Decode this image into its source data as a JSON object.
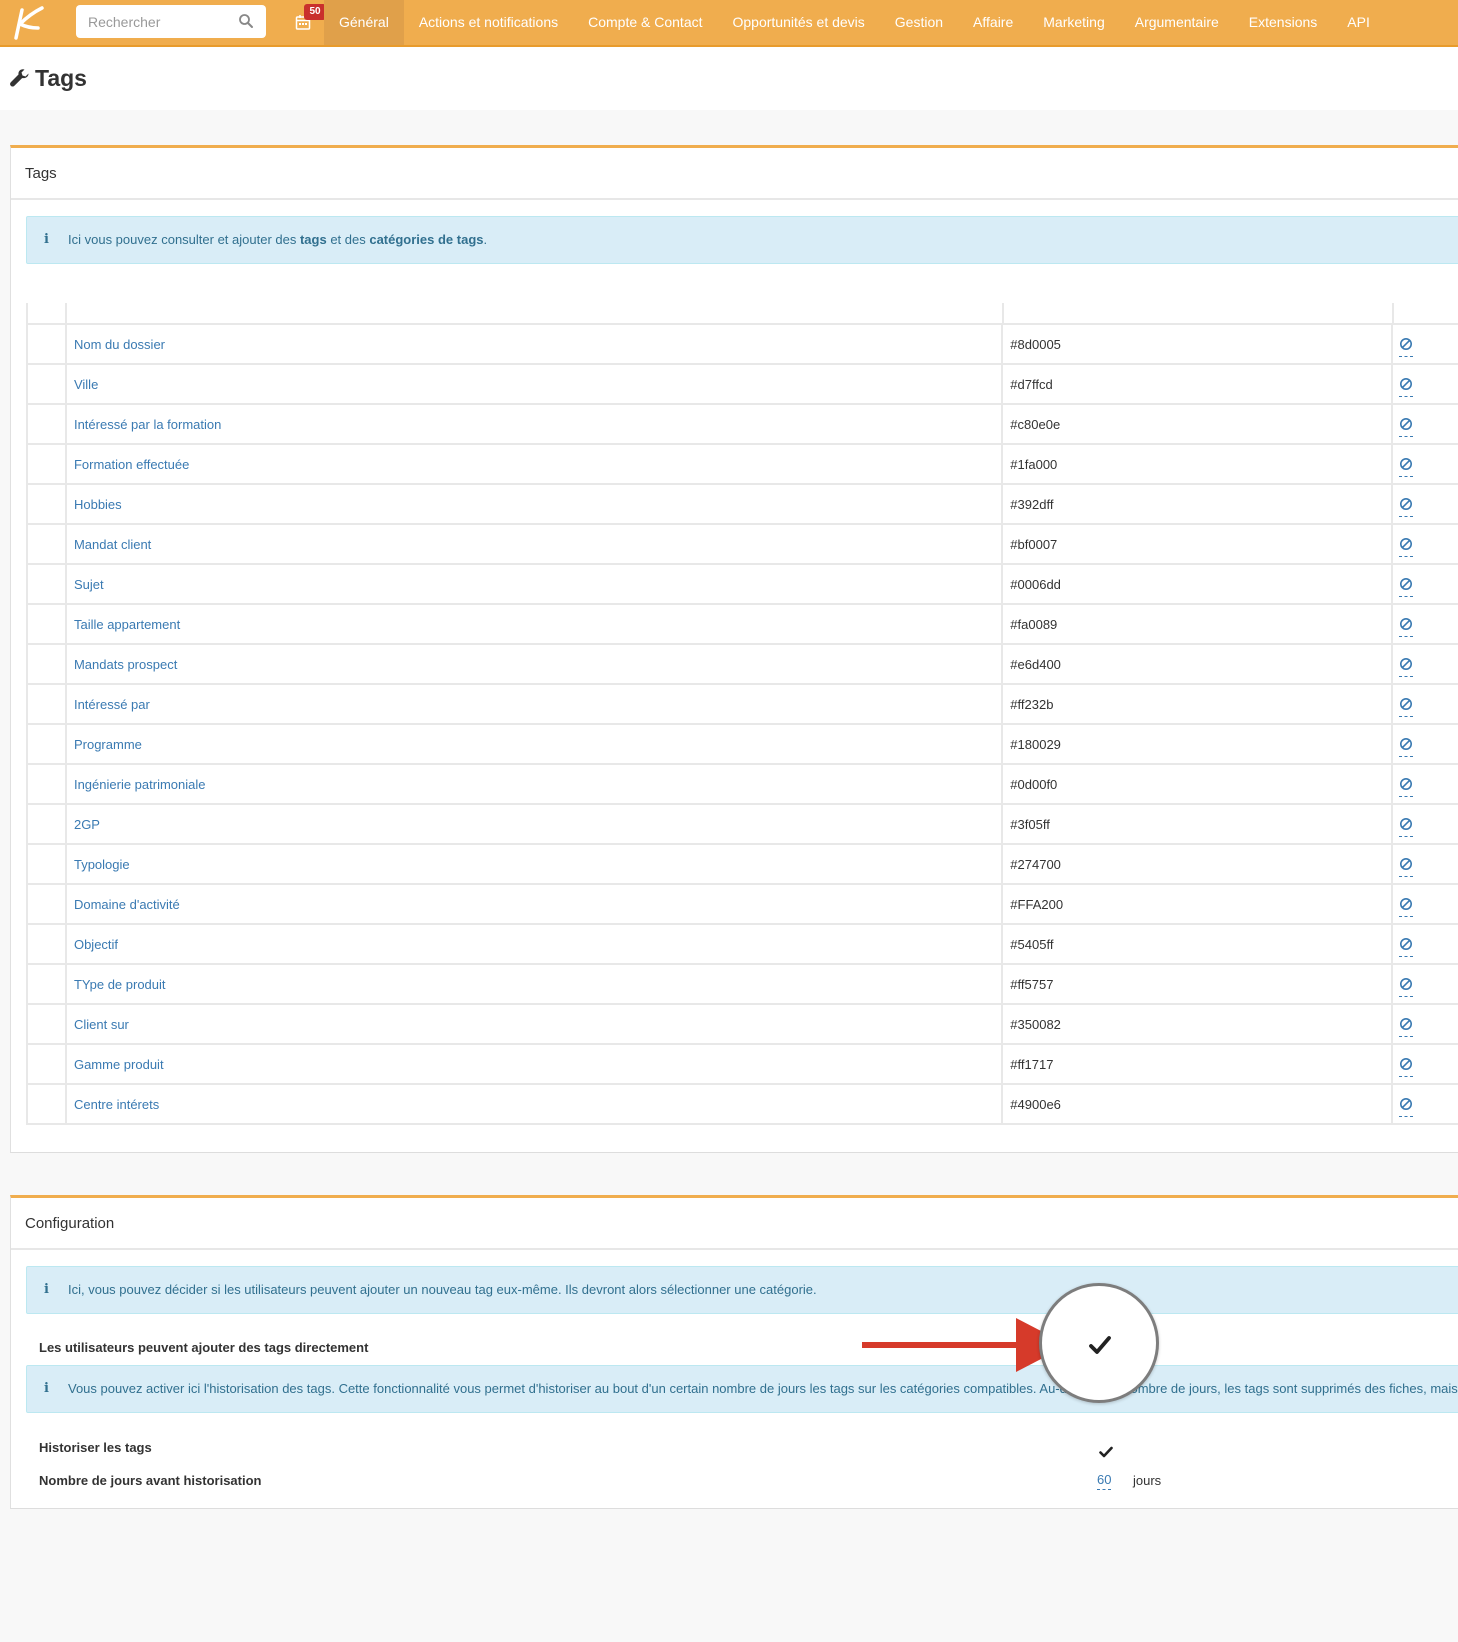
{
  "navbar": {
    "search_placeholder": "Rechercher",
    "badge_count": "50",
    "menu": [
      {
        "label": "Général"
      },
      {
        "label": "Actions et notifications"
      },
      {
        "label": "Compte & Contact"
      },
      {
        "label": "Opportunités et devis"
      },
      {
        "label": "Gestion"
      },
      {
        "label": "Affaire"
      },
      {
        "label": "Marketing"
      },
      {
        "label": "Argumentaire"
      },
      {
        "label": "Extensions"
      },
      {
        "label": "API"
      }
    ],
    "active_item": "Général",
    "accent_color": "#f0ad4e"
  },
  "page": {
    "title": "Tags",
    "icon": "wrench-icon"
  },
  "tags_panel": {
    "title": "Tags",
    "info_prefix": "Ici vous pouvez consulter et ajouter des ",
    "info_bold1": "tags",
    "info_mid": " et des ",
    "info_bold2": "catégories de tags",
    "info_suffix": ".",
    "rows": [
      {
        "name": "Nom du dossier",
        "color": "#8d0005"
      },
      {
        "name": "Ville",
        "color": "#d7ffcd"
      },
      {
        "name": "Intéressé par la formation",
        "color": "#c80e0e"
      },
      {
        "name": "Formation effectuée",
        "color": "#1fa000"
      },
      {
        "name": "Hobbies",
        "color": "#392dff"
      },
      {
        "name": "Mandat client",
        "color": "#bf0007"
      },
      {
        "name": "Sujet",
        "color": "#0006dd"
      },
      {
        "name": "Taille appartement",
        "color": "#fa0089"
      },
      {
        "name": "Mandats prospect",
        "color": "#e6d400"
      },
      {
        "name": "Intéressé par",
        "color": "#ff232b"
      },
      {
        "name": "Programme",
        "color": "#180029"
      },
      {
        "name": "Ingénierie patrimoniale",
        "color": "#0d00f0"
      },
      {
        "name": "2GP",
        "color": "#3f05ff"
      },
      {
        "name": "Typologie",
        "color": "#274700"
      },
      {
        "name": "Domaine d'activité",
        "color": "#FFA200"
      },
      {
        "name": "Objectif",
        "color": "#5405ff"
      },
      {
        "name": "TYpe de produit",
        "color": "#ff5757"
      },
      {
        "name": "Client sur",
        "color": "#350082"
      },
      {
        "name": "Gamme produit",
        "color": "#ff1717"
      },
      {
        "name": "Centre intérets",
        "color": "#4900e6"
      }
    ]
  },
  "config_panel": {
    "title": "Configuration",
    "info1": "Ici, vous pouvez décider si les utilisateurs peuvent ajouter un nouveau tag eux-même. Ils devront alors sélectionner une catégorie.",
    "allow_users_label": "Les utilisateurs peuvent ajouter des tags directement",
    "allow_users_enabled": true,
    "info2": "Vous pouvez activer ici l'historisation des tags. Cette fonctionnalité vous permet d'historiser au bout d'un certain nombre de jours les tags sur les catégories compatibles. Au-delà de ce nombre de jours, les tags sont supprimés des fiches, mais",
    "historize_label": "Historiser les tags",
    "historize_enabled": true,
    "days_label": "Nombre de jours avant historisation",
    "days_value": "60",
    "days_unit": "jours"
  }
}
